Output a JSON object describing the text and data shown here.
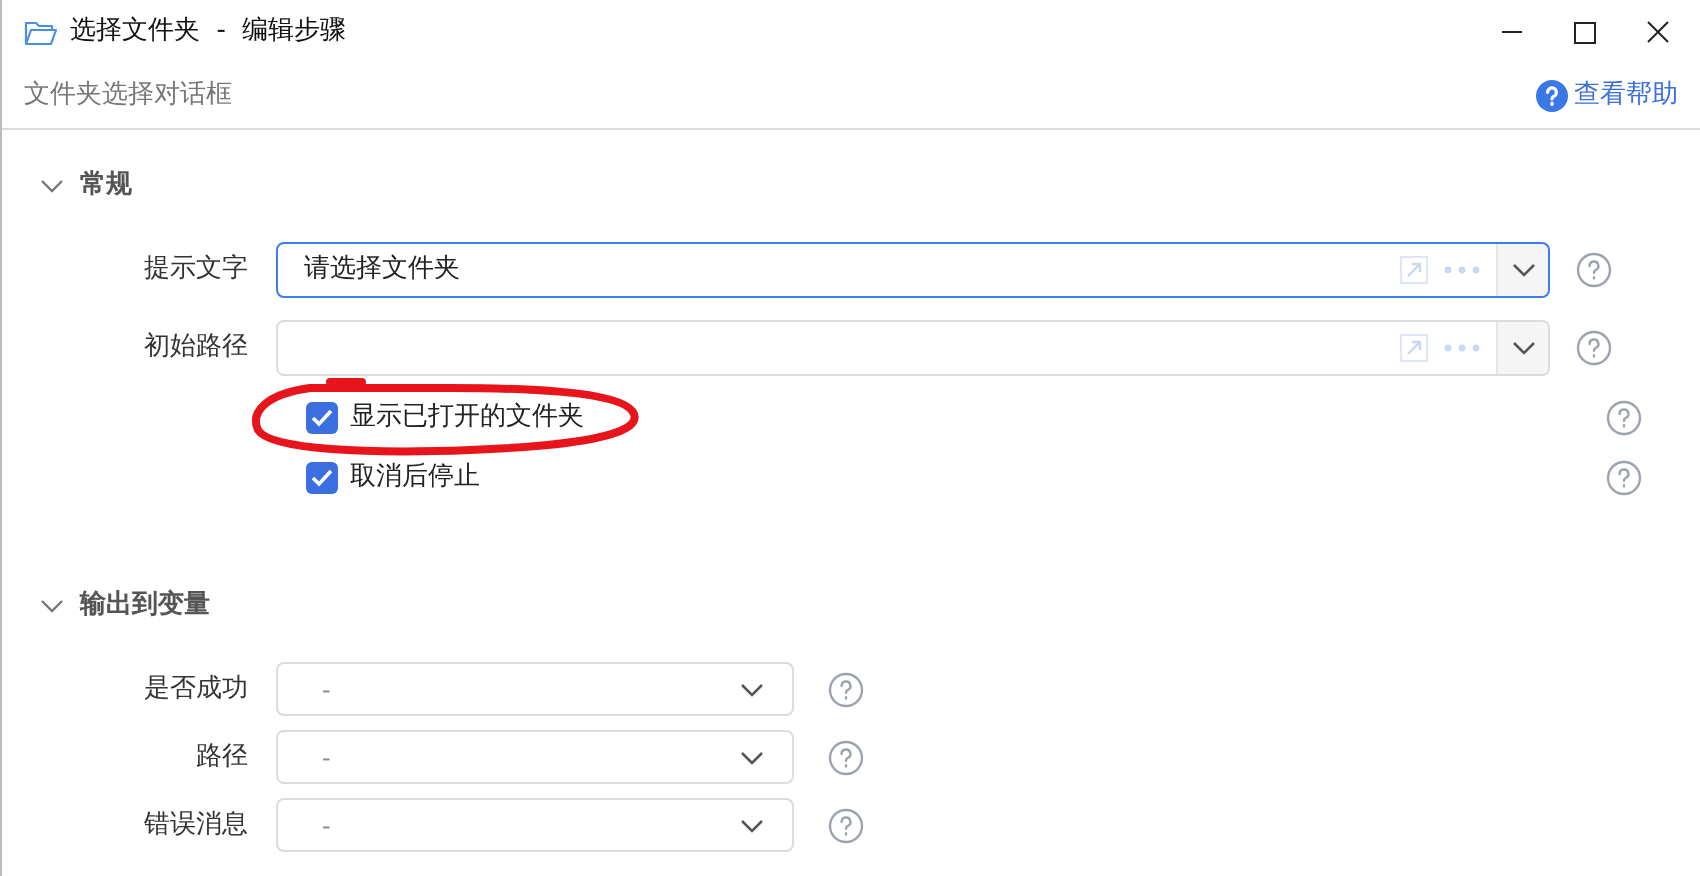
{
  "window": {
    "title": "选择文件夹  -  编辑步骤"
  },
  "header": {
    "subtitle": "文件夹选择对话框",
    "help_link": "查看帮助"
  },
  "sections": [
    {
      "title": "常规",
      "expanded": true,
      "rows": [
        {
          "kind": "text",
          "label": "提示文字",
          "value": "请选择文件夹",
          "focused": true
        },
        {
          "kind": "text",
          "label": "初始路径",
          "focused": false
        },
        {
          "kind": "checkbox",
          "label": "显示已打开的文件夹",
          "checked": true,
          "annotated": true
        },
        {
          "kind": "checkbox",
          "label": "取消后停止",
          "checked": true,
          "annotated": false
        }
      ]
    },
    {
      "title": "输出到变量",
      "expanded": true,
      "rows": [
        {
          "kind": "select",
          "label": "是否成功",
          "value": "-"
        },
        {
          "kind": "select",
          "label": "路径",
          "value": "-"
        },
        {
          "kind": "select",
          "label": "错误消息",
          "value": "-"
        }
      ]
    }
  ]
}
